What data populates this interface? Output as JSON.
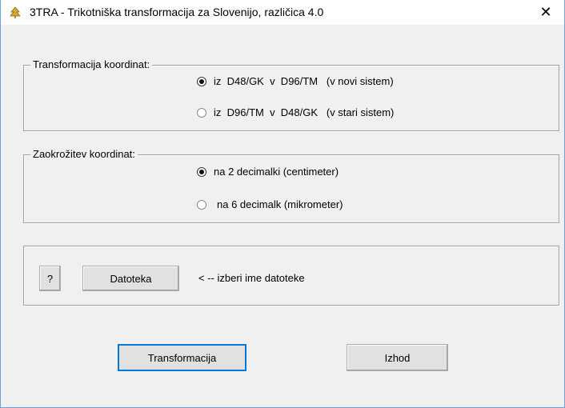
{
  "window": {
    "title": "3TRA - Trikotniška transformacija za Slovenijo, različica 4.0",
    "close_glyph": "✕"
  },
  "group_transform": {
    "legend": "Transformacija koordinat:",
    "options": [
      {
        "label": "iz  D48/GK  v  D96/TM   (v novi sistem)",
        "checked": true
      },
      {
        "label": "iz  D96/TM  v  D48/GK   (v stari sistem)",
        "checked": false
      }
    ]
  },
  "group_rounding": {
    "legend": "Zaokrožitev koordinat:",
    "options": [
      {
        "label": "na 2 decimalki (centimeter)",
        "checked": true
      },
      {
        "label": "na 6 decimalk (mikrometer)",
        "checked": false
      }
    ]
  },
  "file_group": {
    "help_label": "?",
    "file_button_label": "Datoteka",
    "hint": "< -- izberi ime datoteke"
  },
  "actions": {
    "transform_label": "Transformacija",
    "exit_label": "Izhod"
  }
}
